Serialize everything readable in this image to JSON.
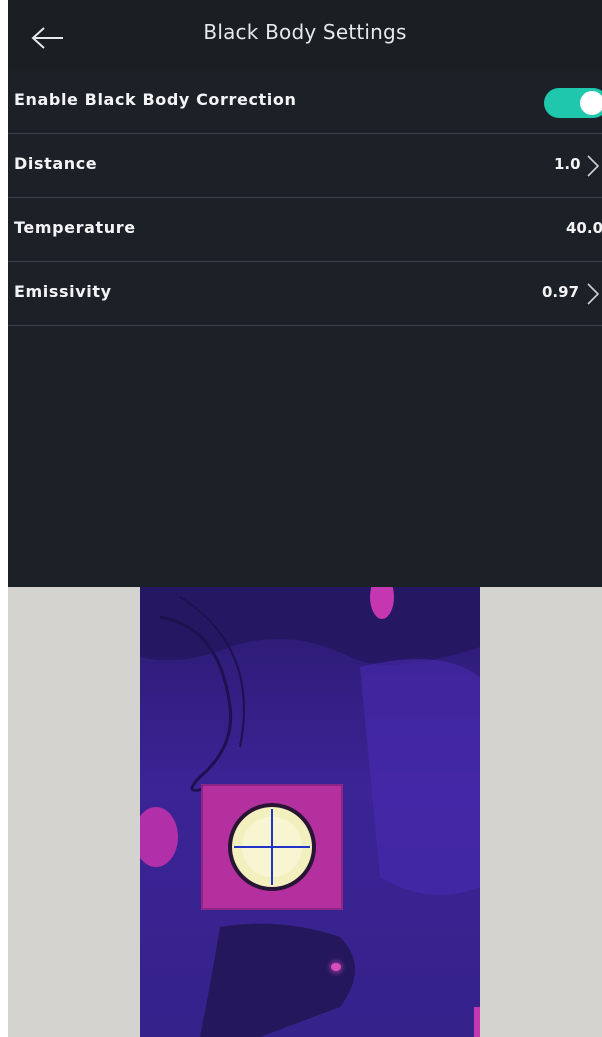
{
  "header": {
    "title": "Black Body Settings",
    "back_icon": "arrow-left-icon"
  },
  "settings": {
    "enable_correction": {
      "label": "Enable Black Body Correction",
      "enabled": true
    },
    "distance": {
      "label": "Distance",
      "value": "1.0"
    },
    "temperature": {
      "label": "Temperature",
      "value": "40.0"
    },
    "emissivity": {
      "label": "Emissivity",
      "value": "0.97"
    }
  },
  "colors": {
    "background": "#1c2127",
    "toggle_on": "#1fc7ad",
    "thermal_base": "#3b1f8f",
    "thermal_hot": "#c437b0"
  }
}
